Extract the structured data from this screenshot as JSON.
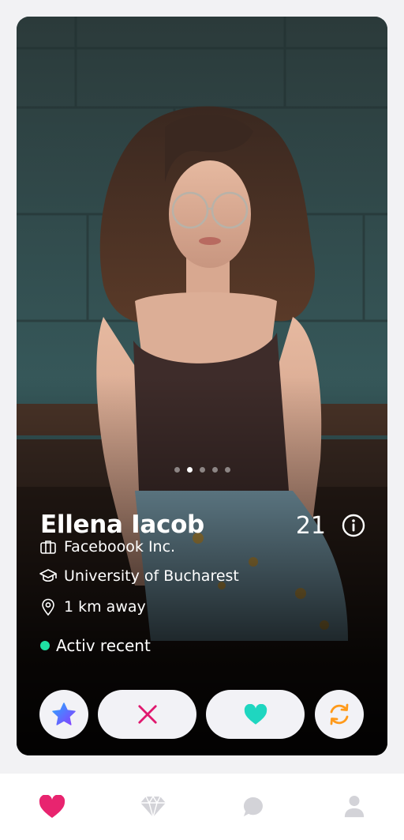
{
  "profile": {
    "name": "Ellena Iacob",
    "age": "21",
    "company": "Faceboook Inc.",
    "school": "University of Bucharest",
    "distance": "1 km away",
    "status": "Activ recent",
    "photo_count": 5,
    "active_photo": 2
  },
  "icons": {
    "info": "info-icon",
    "company": "briefcase-icon",
    "school": "graduation-cap-icon",
    "distance": "location-pin-icon",
    "super_like": "star-icon",
    "nope": "close-icon",
    "like": "heart-icon",
    "rewind": "refresh-icon"
  },
  "nav": {
    "items": [
      {
        "name": "heart-icon",
        "active": true
      },
      {
        "name": "diamond-icon",
        "active": false
      },
      {
        "name": "chat-icon",
        "active": false
      },
      {
        "name": "profile-icon",
        "active": false
      }
    ]
  },
  "colors": {
    "status_active": "#1fe0a4",
    "star_gradient_start": "#2aa8ff",
    "star_gradient_end": "#8a3cff",
    "nope": "#e0186e",
    "like": "#1fd6c0",
    "rewind": "#ff9a1a",
    "nav_active": "#e8246f",
    "nav_inactive": "#d3d3d8"
  }
}
